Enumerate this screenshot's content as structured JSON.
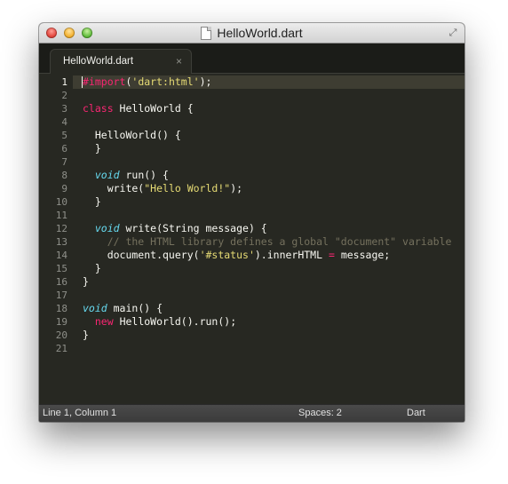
{
  "window": {
    "title": "HelloWorld.dart"
  },
  "tab": {
    "label": "HelloWorld.dart",
    "close_glyph": "×"
  },
  "editor": {
    "current_line": 1,
    "line_numbers": [
      "1",
      "2",
      "3",
      "4",
      "5",
      "6",
      "7",
      "8",
      "9",
      "10",
      "11",
      "12",
      "13",
      "14",
      "15",
      "16",
      "17",
      "18",
      "19",
      "20",
      "21"
    ],
    "lines": [
      [
        {
          "t": "#import",
          "c": "kw"
        },
        {
          "t": "(",
          "c": ""
        },
        {
          "t": "'dart:html'",
          "c": "str"
        },
        {
          "t": ");",
          "c": ""
        }
      ],
      [],
      [
        {
          "t": "class",
          "c": "kw"
        },
        {
          "t": " HelloWorld {",
          "c": ""
        }
      ],
      [],
      [
        {
          "t": "  HelloWorld() {",
          "c": ""
        }
      ],
      [
        {
          "t": "  }",
          "c": ""
        }
      ],
      [],
      [
        {
          "t": "  ",
          "c": ""
        },
        {
          "t": "void",
          "c": "type"
        },
        {
          "t": " run() {",
          "c": ""
        }
      ],
      [
        {
          "t": "    write(",
          "c": ""
        },
        {
          "t": "\"Hello World!\"",
          "c": "str"
        },
        {
          "t": ");",
          "c": ""
        }
      ],
      [
        {
          "t": "  }",
          "c": ""
        }
      ],
      [],
      [
        {
          "t": "  ",
          "c": ""
        },
        {
          "t": "void",
          "c": "type"
        },
        {
          "t": " write(String message) {",
          "c": ""
        }
      ],
      [
        {
          "t": "    // the HTML library defines a global \"document\" variable",
          "c": "comment"
        }
      ],
      [
        {
          "t": "    document.query(",
          "c": ""
        },
        {
          "t": "'#status'",
          "c": "str"
        },
        {
          "t": ").innerHTML ",
          "c": ""
        },
        {
          "t": "=",
          "c": "kw"
        },
        {
          "t": " message;",
          "c": ""
        }
      ],
      [
        {
          "t": "  }",
          "c": ""
        }
      ],
      [
        {
          "t": "}",
          "c": ""
        }
      ],
      [],
      [
        {
          "t": "void",
          "c": "type"
        },
        {
          "t": " main() {",
          "c": ""
        }
      ],
      [
        {
          "t": "  ",
          "c": ""
        },
        {
          "t": "new",
          "c": "kw"
        },
        {
          "t": " HelloWorld().run();",
          "c": ""
        }
      ],
      [
        {
          "t": "}",
          "c": ""
        }
      ],
      []
    ]
  },
  "status": {
    "position": "Line 1, Column 1",
    "indentation": "Spaces: 2",
    "syntax": "Dart"
  },
  "colors": {
    "editor_bg": "#272822",
    "keyword": "#f92672",
    "string": "#e6db74",
    "type": "#66d9ef",
    "comment": "#75715e"
  }
}
